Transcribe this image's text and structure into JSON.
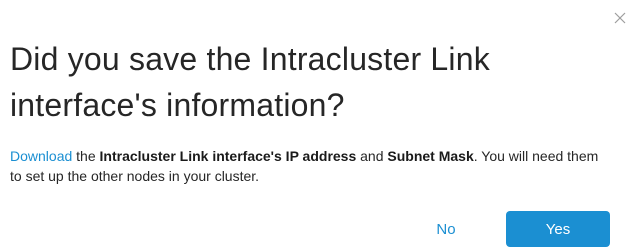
{
  "dialog": {
    "close_icon": "close-icon",
    "title": "Did you save the Intracluster Link interface's information?",
    "message": {
      "link_text": "Download",
      "part1": " the ",
      "bold1": "Intracluster Link interface's IP address",
      "part2": " and ",
      "bold2": "Subnet Mask",
      "part3": ". You will need them to set up the other nodes in your cluster."
    },
    "buttons": {
      "no_label": "No",
      "yes_label": "Yes"
    }
  },
  "colors": {
    "accent": "#1b8fd2",
    "title_text": "#262626",
    "background": "#ffffff"
  }
}
